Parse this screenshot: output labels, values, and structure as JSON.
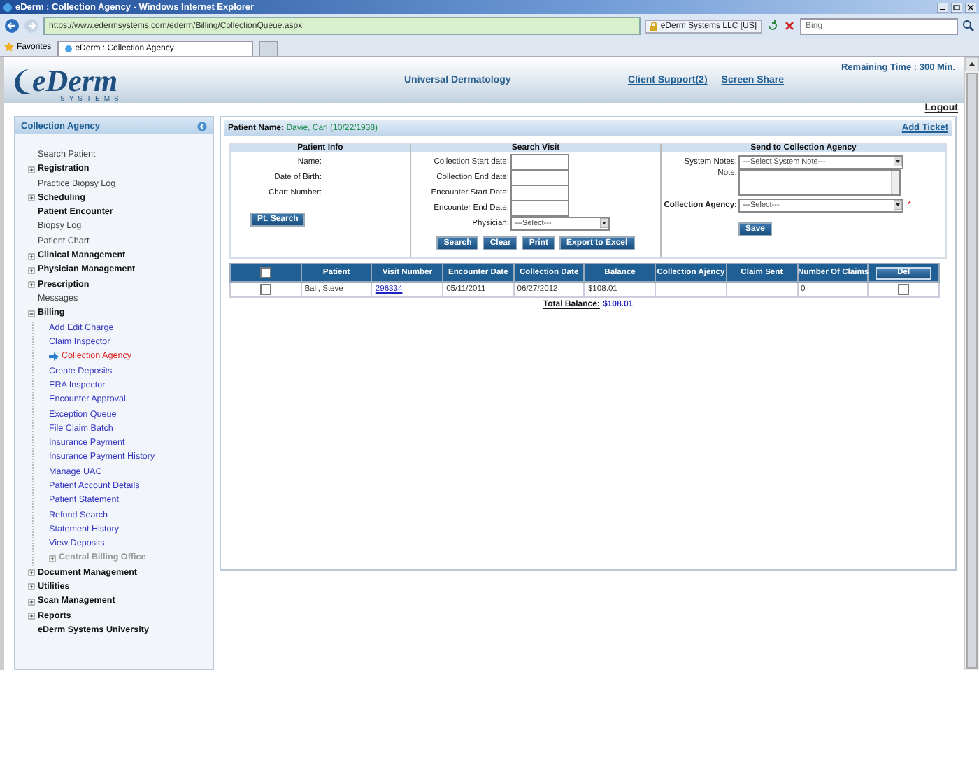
{
  "browser": {
    "title": "eDerm : Collection Agency - Windows Internet Explorer",
    "url": "https://www.edermsystems.com/ederm/Billing/CollectionQueue.aspx",
    "site_identity": "eDerm Systems LLC [US]",
    "search_placeholder": "Bing",
    "favorites": "Favorites",
    "tabs": [
      {
        "label": "eDerm : Collection Agency",
        "selected": true
      }
    ]
  },
  "header": {
    "brand": "eDerm",
    "brand_sub": "SYSTEMS",
    "practice": "Universal Dermatology",
    "links": [
      "Client Support(2)",
      "Screen Share"
    ],
    "remaining_time": "Remaining Time : 300 Min.",
    "logout": "Logout"
  },
  "sidebar": {
    "title": "Collection Agency",
    "items": [
      {
        "label": "Search Patient",
        "kind": "plain",
        "selected": false
      },
      {
        "label": "Registration",
        "kind": "group",
        "expanded": false,
        "selected": false
      },
      {
        "label": "Practice Biopsy Log",
        "kind": "plain",
        "selected": false
      },
      {
        "label": "Scheduling",
        "kind": "group",
        "expanded": false,
        "selected": false
      },
      {
        "label": "Patient Encounter",
        "kind": "bold",
        "selected": false
      },
      {
        "label": "Biopsy Log",
        "kind": "plain",
        "selected": false
      },
      {
        "label": "Patient Chart",
        "kind": "plain",
        "selected": false
      },
      {
        "label": "Clinical Management",
        "kind": "group",
        "expanded": false,
        "selected": false
      },
      {
        "label": "Physician Management",
        "kind": "group",
        "expanded": false,
        "selected": false
      },
      {
        "label": "Prescription",
        "kind": "group",
        "expanded": false,
        "selected": false
      },
      {
        "label": "Messages",
        "kind": "plain",
        "selected": false
      },
      {
        "label": "Billing",
        "kind": "group",
        "expanded": true,
        "selected": false,
        "children": [
          {
            "label": "Add Edit Charge",
            "kind": "link",
            "selected": false
          },
          {
            "label": "Claim Inspector",
            "kind": "link",
            "selected": false
          },
          {
            "label": "Collection Agency",
            "kind": "link",
            "selected": true
          },
          {
            "label": "Create Deposits",
            "kind": "link",
            "selected": false
          },
          {
            "label": "ERA Inspector",
            "kind": "link",
            "selected": false
          },
          {
            "label": "Encounter Approval",
            "kind": "link",
            "selected": false
          },
          {
            "label": "Exception Queue",
            "kind": "link",
            "selected": false
          },
          {
            "label": "File Claim Batch",
            "kind": "link",
            "selected": false
          },
          {
            "label": "Insurance Payment",
            "kind": "link",
            "selected": false
          },
          {
            "label": "Insurance Payment History",
            "kind": "link",
            "selected": false
          },
          {
            "label": "Manage UAC",
            "kind": "link",
            "selected": false
          },
          {
            "label": "Patient Account Details",
            "kind": "link",
            "selected": false
          },
          {
            "label": "Patient Statement",
            "kind": "link",
            "selected": false
          },
          {
            "label": "Refund Search",
            "kind": "link",
            "selected": false
          },
          {
            "label": "Statement History",
            "kind": "link",
            "selected": false
          },
          {
            "label": "View Deposits",
            "kind": "link",
            "selected": false
          },
          {
            "label": "Central Billing Office",
            "kind": "group",
            "expanded": false,
            "selected": false
          }
        ]
      },
      {
        "label": "Document Management",
        "kind": "group",
        "expanded": false,
        "selected": false
      },
      {
        "label": "Utilities",
        "kind": "group",
        "expanded": false,
        "selected": false
      },
      {
        "label": "Scan Management",
        "kind": "group",
        "expanded": false,
        "selected": false
      },
      {
        "label": "Reports",
        "kind": "group",
        "expanded": false,
        "selected": false
      },
      {
        "label": "eDerm Systems University",
        "kind": "bold",
        "selected": false
      }
    ]
  },
  "patient_bar": {
    "label": "Patient Name:",
    "value": "Davie, Carl (10/22/1938)",
    "add_ticket": "Add Ticket"
  },
  "patient_info": {
    "title": "Patient Info",
    "fields": [
      "Name:",
      "Date of Birth:",
      "Chart Number:"
    ],
    "button": "Pt. Search"
  },
  "search_visit": {
    "title": "Search Visit",
    "fields": [
      {
        "label": "Collection Start date:",
        "kind": "text"
      },
      {
        "label": "Collection End date:",
        "kind": "text"
      },
      {
        "label": "Encounter Start Date:",
        "kind": "text"
      },
      {
        "label": "Encounter End Date:",
        "kind": "text"
      },
      {
        "label": "Physician:",
        "kind": "select",
        "value": "---Select---"
      }
    ],
    "buttons": [
      "Search",
      "Clear",
      "Print",
      "Export to Excel"
    ]
  },
  "send_to_agency": {
    "title": "Send to Collection Agency",
    "fields": [
      {
        "label": "System Notes:",
        "kind": "select",
        "value": "---Select System Note---",
        "required": false
      },
      {
        "label": "Note:",
        "kind": "textarea",
        "required": false
      },
      {
        "label": "Collection Agency:",
        "kind": "select",
        "value": "---Select---",
        "required": true,
        "required_mark": "*"
      }
    ],
    "button": "Save"
  },
  "table": {
    "columns": [
      {
        "kind": "checkbox",
        "checked": false
      },
      {
        "kind": "text",
        "label": "Patient"
      },
      {
        "kind": "text",
        "label": "Visit Number"
      },
      {
        "kind": "text",
        "label": "Encounter Date"
      },
      {
        "kind": "text",
        "label": "Collection Date"
      },
      {
        "kind": "text",
        "label": "Balance"
      },
      {
        "kind": "text",
        "label": "Collection Ajency"
      },
      {
        "kind": "text",
        "label": "Claim Sent"
      },
      {
        "kind": "text",
        "label": "Number Of Claims"
      },
      {
        "kind": "button",
        "label": "Del"
      }
    ],
    "rows": [
      {
        "selected": false,
        "patient": "Ball, Steve",
        "visit_number": "296334",
        "encounter_date": "05/11/2011",
        "collection_date": "06/27/2012",
        "balance": "$108.01",
        "number_of_claims": "0",
        "delete": false
      }
    ]
  },
  "total": {
    "label": "Total Balance:",
    "value": "$108.01"
  }
}
